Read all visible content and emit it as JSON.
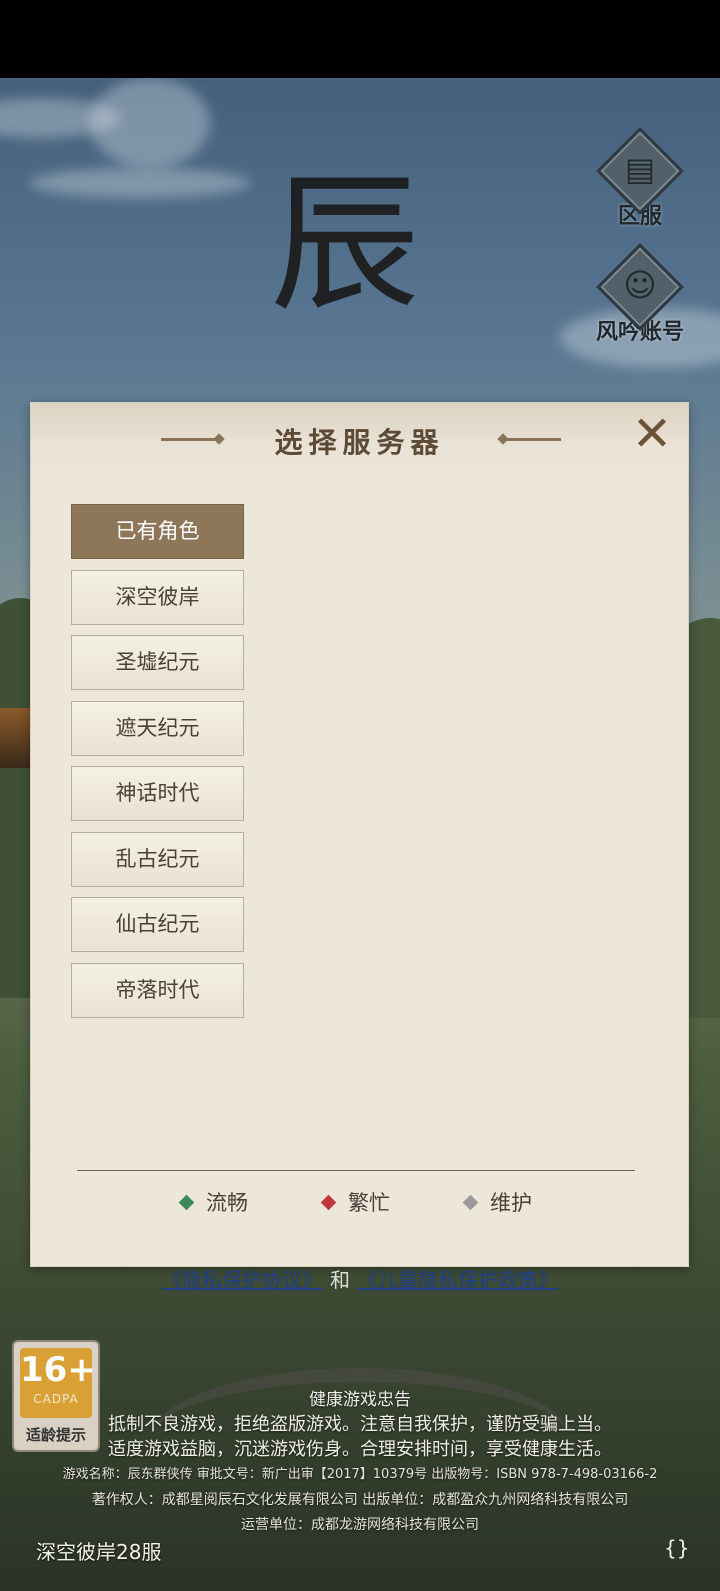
{
  "side_buttons": {
    "server_zone": {
      "label": "区服",
      "icon": "gate-icon"
    },
    "account": {
      "label": "风吟账号",
      "icon": "avatar-icon"
    }
  },
  "logo_glyph": "辰",
  "dialog": {
    "title": "选择服务器",
    "close_icon": "close-icon",
    "servers": [
      {
        "label": "已有角色",
        "active": true
      },
      {
        "label": "深空彼岸",
        "active": false
      },
      {
        "label": "圣墟纪元",
        "active": false
      },
      {
        "label": "遮天纪元",
        "active": false
      },
      {
        "label": "神话时代",
        "active": false
      },
      {
        "label": "乱古纪元",
        "active": false
      },
      {
        "label": "仙古纪元",
        "active": false
      },
      {
        "label": "帝落时代",
        "active": false
      }
    ],
    "legend": [
      {
        "label": "流畅",
        "color": "#3c8a5a"
      },
      {
        "label": "繁忙",
        "color": "#c0363a"
      },
      {
        "label": "维护",
        "color": "#9a9a9a"
      }
    ]
  },
  "privacy": {
    "link1": "《隐私保护协议》",
    "and": "和",
    "link2": "《儿童隐私保护政策》"
  },
  "age_badge": {
    "rating": "16+",
    "org": "CADPA",
    "caption": "适龄提示"
  },
  "notice": {
    "title": "健康游戏忠告",
    "line1": "抵制不良游戏，拒绝盗版游戏。注意自我保护，谨防受骗上当。",
    "line2": "适度游戏益脑，沉迷游戏伤身。合理安排时间，享受健康生活。",
    "line3": "游戏名称：辰东群侠传  审批文号：新广出审【2017】10379号  出版物号：ISBN  978-7-498-03166-2",
    "line4": "著作权人：成都星阅辰石文化发展有限公司  出版单位：成都盈众九州网络科技有限公司",
    "line5": "运营单位：成都龙游网络科技有限公司"
  },
  "current_server": "深空彼岸28服",
  "corner_icon": "{}"
}
